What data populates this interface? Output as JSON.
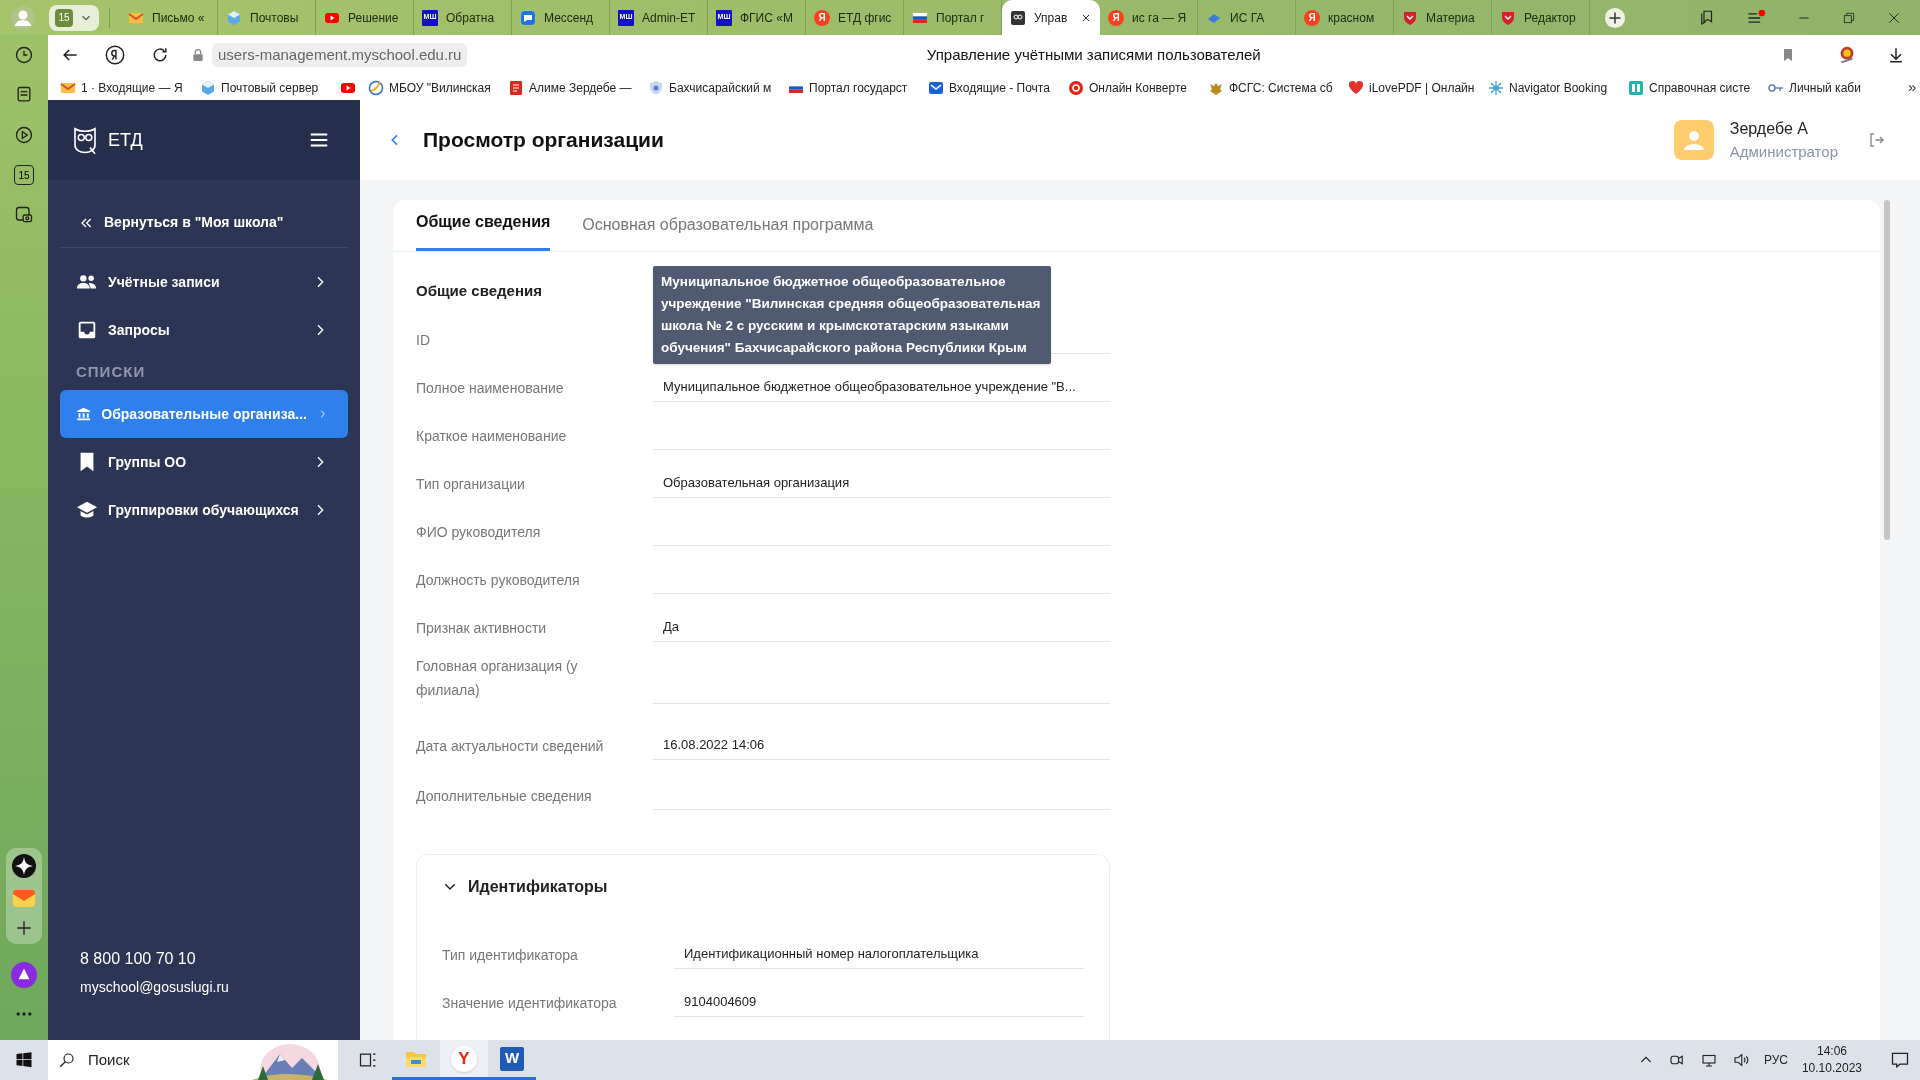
{
  "browser": {
    "tab_counter": "15",
    "tabs": [
      {
        "kind": "mail",
        "label": "Письмо «",
        "selected": false
      },
      {
        "kind": "cube",
        "label": "Почтовы",
        "selected": false
      },
      {
        "kind": "video",
        "label": "Решение",
        "selected": false
      },
      {
        "kind": "msh",
        "icon_text": "МШ",
        "label": "Обратна",
        "selected": false
      },
      {
        "kind": "chat",
        "label": "Мессенд",
        "selected": false
      },
      {
        "kind": "msh",
        "icon_text": "МШ",
        "label": "Admin-ЕТ",
        "selected": false
      },
      {
        "kind": "msh",
        "icon_text": "МШ",
        "label": "ФГИС «М",
        "selected": false
      },
      {
        "kind": "yandex",
        "icon_text": "Я",
        "label": "ЕТД фгис",
        "selected": false
      },
      {
        "kind": "flag",
        "label": "Портал г",
        "selected": false
      },
      {
        "kind": "owl",
        "label": "Управ",
        "selected": true
      },
      {
        "kind": "yandex",
        "icon_text": "Я",
        "label": "ис га — Я",
        "selected": false
      },
      {
        "kind": "bird",
        "label": "ИС ГА",
        "selected": false
      },
      {
        "kind": "yandex",
        "icon_text": "Я",
        "label": "красном",
        "selected": false
      },
      {
        "kind": "emblem",
        "label": "Материа",
        "selected": false
      },
      {
        "kind": "emblem",
        "label": "Редактор",
        "selected": false
      }
    ],
    "address": "users-management.myschool.edu.ru",
    "page_title": "Управление учётными записями пользователей",
    "bookmarks": [
      {
        "kind": "mail",
        "label": "1 · Входящие — Я"
      },
      {
        "kind": "cube",
        "label": "Почтовый сервер"
      },
      {
        "kind": "video"
      },
      {
        "kind": "globe",
        "label": "МБОУ \"Вилинская"
      },
      {
        "kind": "doc",
        "label": "Алиме Зердебе —"
      },
      {
        "kind": "shield",
        "label": "Бахчисарайский м"
      },
      {
        "kind": "flag",
        "label": "Портал государст"
      },
      {
        "kind": "envelope",
        "label": "Входящие - Почта"
      },
      {
        "kind": "convert",
        "label": "Онлайн Конверте"
      },
      {
        "kind": "eagle",
        "label": "ФСГС: Система сб"
      },
      {
        "kind": "heart",
        "label": "iLovePDF | Онлайн"
      },
      {
        "kind": "star",
        "label": "Navigator Booking"
      },
      {
        "kind": "book",
        "label": "Справочная систе"
      },
      {
        "kind": "key",
        "label": "Личный каби"
      }
    ],
    "bookmarks_more": "»",
    "rail_calendar": "15"
  },
  "sidebar": {
    "logo": "ЕТД",
    "items": [
      {
        "kind": "back",
        "label": "Вернуться в \"Моя школа\"",
        "selected": false
      },
      {
        "kind": "nav",
        "label": "Учётные записи",
        "selected": false
      },
      {
        "kind": "nav",
        "label": "Запросы",
        "selected": false
      },
      {
        "kind": "heading",
        "label": "СПИСКИ"
      },
      {
        "kind": "nav",
        "label": "Образовательные организа...",
        "selected": true
      },
      {
        "kind": "nav",
        "label": "Группы ОО",
        "selected": false
      },
      {
        "kind": "nav",
        "label": "Группировки обучающихся",
        "selected": false
      }
    ],
    "phone": "8 800 100 70 10",
    "email": "myschool@gosuslugi.ru"
  },
  "header": {
    "title": "Просмотр организации",
    "user_name": "Зердебе А",
    "user_role": "Администратор"
  },
  "tabs": [
    {
      "label": "Общие сведения",
      "selected": true
    },
    {
      "label": "Основная образовательная программа",
      "selected": false
    }
  ],
  "section_title": "Общие сведения",
  "tooltip": "Муниципальное бюджетное общеобразовательное учреждение \"Вилинская средняя общеобразовательная школа № 2 с русским и крымскотатарским языками обучения\" Бахчисарайского района Республики Крым",
  "fields": [
    {
      "label": "ID"
    },
    {
      "label": "Полное наименование",
      "value": "Муниципальное бюджетное общеобразовательное учреждение \"В..."
    },
    {
      "label": "Краткое наименование"
    },
    {
      "label": "Тип организации",
      "value": "Образовательная организация"
    },
    {
      "label": "ФИО руководителя"
    },
    {
      "label": "Должность руководителя"
    },
    {
      "label": "Признак активности",
      "value": "Да"
    },
    {
      "label": "Головная организация (у филиала)"
    },
    {
      "label": "Дата актуальности сведений",
      "value": "16.08.2022 14:06"
    },
    {
      "label": "Дополнительные сведения"
    }
  ],
  "identifiers": {
    "title": "Идентификаторы",
    "expanded": true,
    "fields": [
      {
        "label": "Тип идентификатора",
        "value": "Идентификационный номер налогоплательщика"
      },
      {
        "label": "Значение идентификатора",
        "value": "9104004609"
      }
    ]
  },
  "taskbar": {
    "search_placeholder": "Поиск",
    "apps": [
      {
        "kind": "taskview",
        "selected": false
      },
      {
        "kind": "folder",
        "selected": false
      },
      {
        "kind": "yandex",
        "icon_text": "Y",
        "selected": true
      },
      {
        "kind": "word",
        "icon_text": "W",
        "selected": false
      }
    ],
    "language": "РУС",
    "time": "14:06",
    "date": "10.10.2023"
  }
}
